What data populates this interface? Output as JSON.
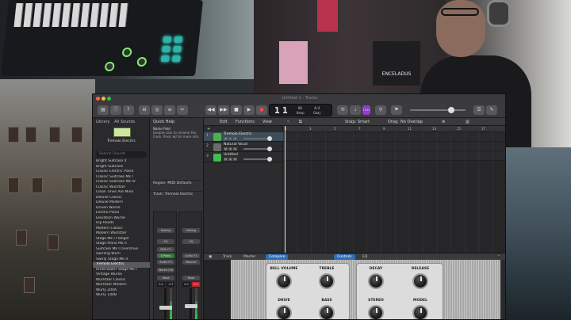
{
  "window": {
    "title": "Untitled 1 - Tracks"
  },
  "toolbar": {
    "lcd_bar": "1",
    "lcd_beat": "1",
    "lcd_tempo": "80",
    "lcd_tempo_sub": "Keep",
    "lcd_sig": "4/4",
    "lcd_key": "Cmaj",
    "key_badge": "1234"
  },
  "library": {
    "header": "Library",
    "scope": "All Sounds",
    "patch_name": "Tremolo Electric",
    "search_placeholder": "Search Sounds",
    "items": [
      "Bright Suitcase II",
      "Bright Suitcase",
      "Classic Electric Piano",
      "Classic Suitcase Mk I",
      "Classic Suitcase Mk IV",
      "Classic Wurlitzer",
      "Clean Tines Are Mine",
      "Deluxe Classic",
      "Deluxe Modern",
      "Driven Wurlie",
      "Electro Piano",
      "Elevation Wurlie",
      "Hip Roads",
      "Modern Classic",
      "Modern Wurlitzer",
      "Stage Mk I Flanger",
      "Stage Piano Mk II",
      "Suitcase Mk I Overdrive",
      "Swirling Wurli",
      "Swirly Stage Mk II",
      "Tremolo Electric",
      "Underwater Stage Mk I",
      "Vintage Wurlie",
      "Wurlitzer Classic",
      "Wurlitzer Modern",
      "Wurly 200A",
      "Wurly 140B"
    ],
    "selected_index": 20
  },
  "inspector": {
    "title": "Quick Help",
    "help_heading": "Name field",
    "help_body": "Double-click to rename the track. Press ⌘/ for more info.",
    "region": "Region: MIDI Defaults",
    "track": "Track: Tremolo Electric",
    "strip1": {
      "setting": "Setting",
      "eq": "EQ",
      "midi_fx": "MIDI FX",
      "instrument": "E.Piano",
      "audio_fx": "Audio FX",
      "send": "Stereo Out",
      "mode": "Read",
      "val1": "0.0",
      "val2": "-3.3"
    },
    "strip2": {
      "setting": "Setting",
      "eq": "EQ",
      "instrument": "Audio FX",
      "audio_fx": "Bounce",
      "mode": "Read",
      "val1": "0.0",
      "val2": "0.0"
    }
  },
  "tracks_pane": {
    "menu_edit": "Edit",
    "menu_functions": "Functions",
    "menu_view": "View",
    "snap_label": "Snap:",
    "snap_value": "Smart",
    "drag_label": "Drag:",
    "drag_value": "No Overlap",
    "ruler": [
      "1",
      "3",
      "5",
      "7",
      "9",
      "11",
      "13",
      "15",
      "17",
      "19"
    ],
    "tracks": [
      {
        "num": "1",
        "name": "Tremolo Electric",
        "color": "#4caf50"
      },
      {
        "num": "2",
        "name": "Natural Vocal",
        "color": "#6b6b6b"
      },
      {
        "num": "3",
        "name": "Untitled",
        "color": "#3fbe51"
      }
    ]
  },
  "control_bar": {
    "track_tab": "Track",
    "master_tab": "Master",
    "compare": "Compare",
    "controls_tab": "Controls",
    "eq_tab": "EQ"
  },
  "plugin": {
    "bell_volume": "BELL VOLUME",
    "treble": "TREBLE",
    "drive": "DRIVE",
    "bass": "BASS",
    "decay": "DECAY",
    "release": "RELEASE",
    "stereo": "STEREO",
    "model": "MODEL"
  },
  "hardware": {
    "poster_text": "ENCELADUS"
  }
}
